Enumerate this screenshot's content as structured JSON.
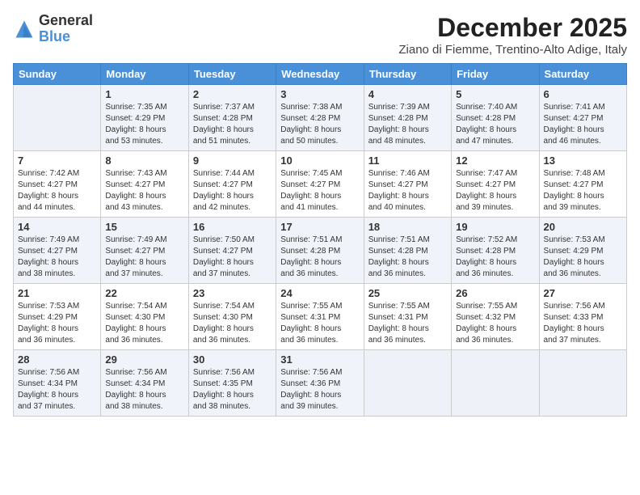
{
  "logo": {
    "general": "General",
    "blue": "Blue"
  },
  "title": "December 2025",
  "subtitle": "Ziano di Fiemme, Trentino-Alto Adige, Italy",
  "weekdays": [
    "Sunday",
    "Monday",
    "Tuesday",
    "Wednesday",
    "Thursday",
    "Friday",
    "Saturday"
  ],
  "weeks": [
    [
      {
        "day": "",
        "info": ""
      },
      {
        "day": "1",
        "info": "Sunrise: 7:35 AM\nSunset: 4:29 PM\nDaylight: 8 hours\nand 53 minutes."
      },
      {
        "day": "2",
        "info": "Sunrise: 7:37 AM\nSunset: 4:28 PM\nDaylight: 8 hours\nand 51 minutes."
      },
      {
        "day": "3",
        "info": "Sunrise: 7:38 AM\nSunset: 4:28 PM\nDaylight: 8 hours\nand 50 minutes."
      },
      {
        "day": "4",
        "info": "Sunrise: 7:39 AM\nSunset: 4:28 PM\nDaylight: 8 hours\nand 48 minutes."
      },
      {
        "day": "5",
        "info": "Sunrise: 7:40 AM\nSunset: 4:28 PM\nDaylight: 8 hours\nand 47 minutes."
      },
      {
        "day": "6",
        "info": "Sunrise: 7:41 AM\nSunset: 4:27 PM\nDaylight: 8 hours\nand 46 minutes."
      }
    ],
    [
      {
        "day": "7",
        "info": "Sunrise: 7:42 AM\nSunset: 4:27 PM\nDaylight: 8 hours\nand 44 minutes."
      },
      {
        "day": "8",
        "info": "Sunrise: 7:43 AM\nSunset: 4:27 PM\nDaylight: 8 hours\nand 43 minutes."
      },
      {
        "day": "9",
        "info": "Sunrise: 7:44 AM\nSunset: 4:27 PM\nDaylight: 8 hours\nand 42 minutes."
      },
      {
        "day": "10",
        "info": "Sunrise: 7:45 AM\nSunset: 4:27 PM\nDaylight: 8 hours\nand 41 minutes."
      },
      {
        "day": "11",
        "info": "Sunrise: 7:46 AM\nSunset: 4:27 PM\nDaylight: 8 hours\nand 40 minutes."
      },
      {
        "day": "12",
        "info": "Sunrise: 7:47 AM\nSunset: 4:27 PM\nDaylight: 8 hours\nand 39 minutes."
      },
      {
        "day": "13",
        "info": "Sunrise: 7:48 AM\nSunset: 4:27 PM\nDaylight: 8 hours\nand 39 minutes."
      }
    ],
    [
      {
        "day": "14",
        "info": "Sunrise: 7:49 AM\nSunset: 4:27 PM\nDaylight: 8 hours\nand 38 minutes."
      },
      {
        "day": "15",
        "info": "Sunrise: 7:49 AM\nSunset: 4:27 PM\nDaylight: 8 hours\nand 37 minutes."
      },
      {
        "day": "16",
        "info": "Sunrise: 7:50 AM\nSunset: 4:27 PM\nDaylight: 8 hours\nand 37 minutes."
      },
      {
        "day": "17",
        "info": "Sunrise: 7:51 AM\nSunset: 4:28 PM\nDaylight: 8 hours\nand 36 minutes."
      },
      {
        "day": "18",
        "info": "Sunrise: 7:51 AM\nSunset: 4:28 PM\nDaylight: 8 hours\nand 36 minutes."
      },
      {
        "day": "19",
        "info": "Sunrise: 7:52 AM\nSunset: 4:28 PM\nDaylight: 8 hours\nand 36 minutes."
      },
      {
        "day": "20",
        "info": "Sunrise: 7:53 AM\nSunset: 4:29 PM\nDaylight: 8 hours\nand 36 minutes."
      }
    ],
    [
      {
        "day": "21",
        "info": "Sunrise: 7:53 AM\nSunset: 4:29 PM\nDaylight: 8 hours\nand 36 minutes."
      },
      {
        "day": "22",
        "info": "Sunrise: 7:54 AM\nSunset: 4:30 PM\nDaylight: 8 hours\nand 36 minutes."
      },
      {
        "day": "23",
        "info": "Sunrise: 7:54 AM\nSunset: 4:30 PM\nDaylight: 8 hours\nand 36 minutes."
      },
      {
        "day": "24",
        "info": "Sunrise: 7:55 AM\nSunset: 4:31 PM\nDaylight: 8 hours\nand 36 minutes."
      },
      {
        "day": "25",
        "info": "Sunrise: 7:55 AM\nSunset: 4:31 PM\nDaylight: 8 hours\nand 36 minutes."
      },
      {
        "day": "26",
        "info": "Sunrise: 7:55 AM\nSunset: 4:32 PM\nDaylight: 8 hours\nand 36 minutes."
      },
      {
        "day": "27",
        "info": "Sunrise: 7:56 AM\nSunset: 4:33 PM\nDaylight: 8 hours\nand 37 minutes."
      }
    ],
    [
      {
        "day": "28",
        "info": "Sunrise: 7:56 AM\nSunset: 4:34 PM\nDaylight: 8 hours\nand 37 minutes."
      },
      {
        "day": "29",
        "info": "Sunrise: 7:56 AM\nSunset: 4:34 PM\nDaylight: 8 hours\nand 38 minutes."
      },
      {
        "day": "30",
        "info": "Sunrise: 7:56 AM\nSunset: 4:35 PM\nDaylight: 8 hours\nand 38 minutes."
      },
      {
        "day": "31",
        "info": "Sunrise: 7:56 AM\nSunset: 4:36 PM\nDaylight: 8 hours\nand 39 minutes."
      },
      {
        "day": "",
        "info": ""
      },
      {
        "day": "",
        "info": ""
      },
      {
        "day": "",
        "info": ""
      }
    ]
  ]
}
